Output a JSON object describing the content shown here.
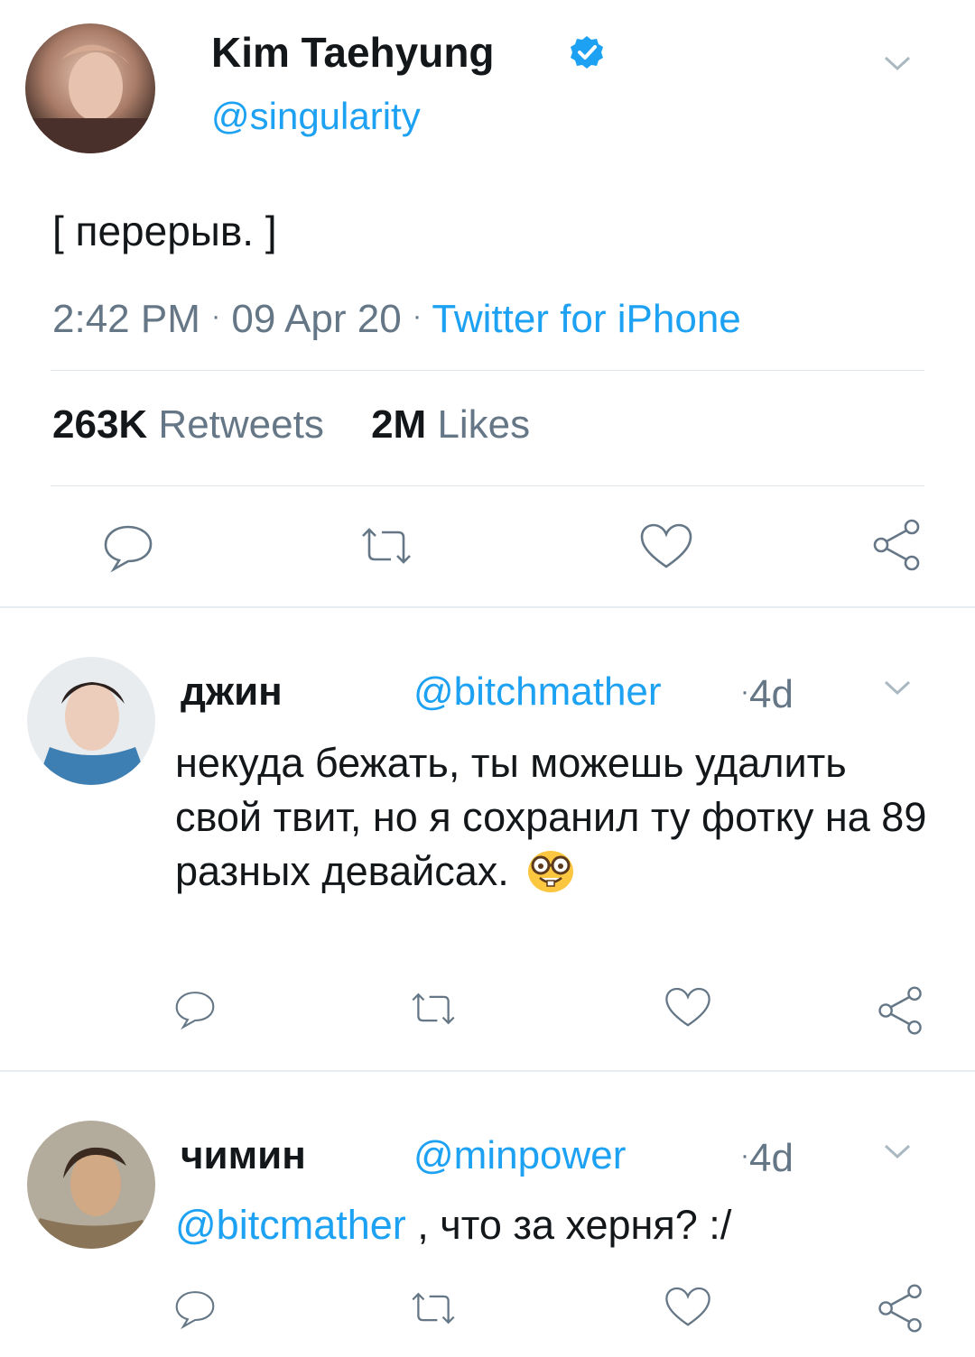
{
  "main_tweet": {
    "author_name": "Kim Taehyung",
    "verified_icon": "verified-badge-icon",
    "handle": "@singularity",
    "text": "[ перерыв. ]",
    "time": "2:42 PM",
    "dot1": "·",
    "date": "09 Apr 20",
    "dot2": "·",
    "source": "Twitter for iPhone",
    "retweets_count": "263K",
    "retweets_label": "Retweets",
    "likes_count": "2M",
    "likes_label": "Likes"
  },
  "replies": [
    {
      "author_name": "джин",
      "handle": "@bitchmather",
      "dot": "·",
      "age": "4d",
      "text": "некуда бежать, ты можешь удалить свой твит, но я сохранил ту фотку на 89 разных девайсах.",
      "emoji": "nerd-face-emoji"
    },
    {
      "author_name": "чимин",
      "handle": "@minpower",
      "dot": "·",
      "age": "4d",
      "mention": "@bitcmather",
      "text": " , что за херня? :/"
    }
  ],
  "colors": {
    "link_blue": "#1da1f2",
    "meta_gray": "#657786",
    "divider": "#e1e8ed"
  },
  "icons": [
    "chevron-down-icon",
    "reply-icon",
    "retweet-icon",
    "like-icon",
    "share-icon",
    "verified-badge-icon"
  ]
}
